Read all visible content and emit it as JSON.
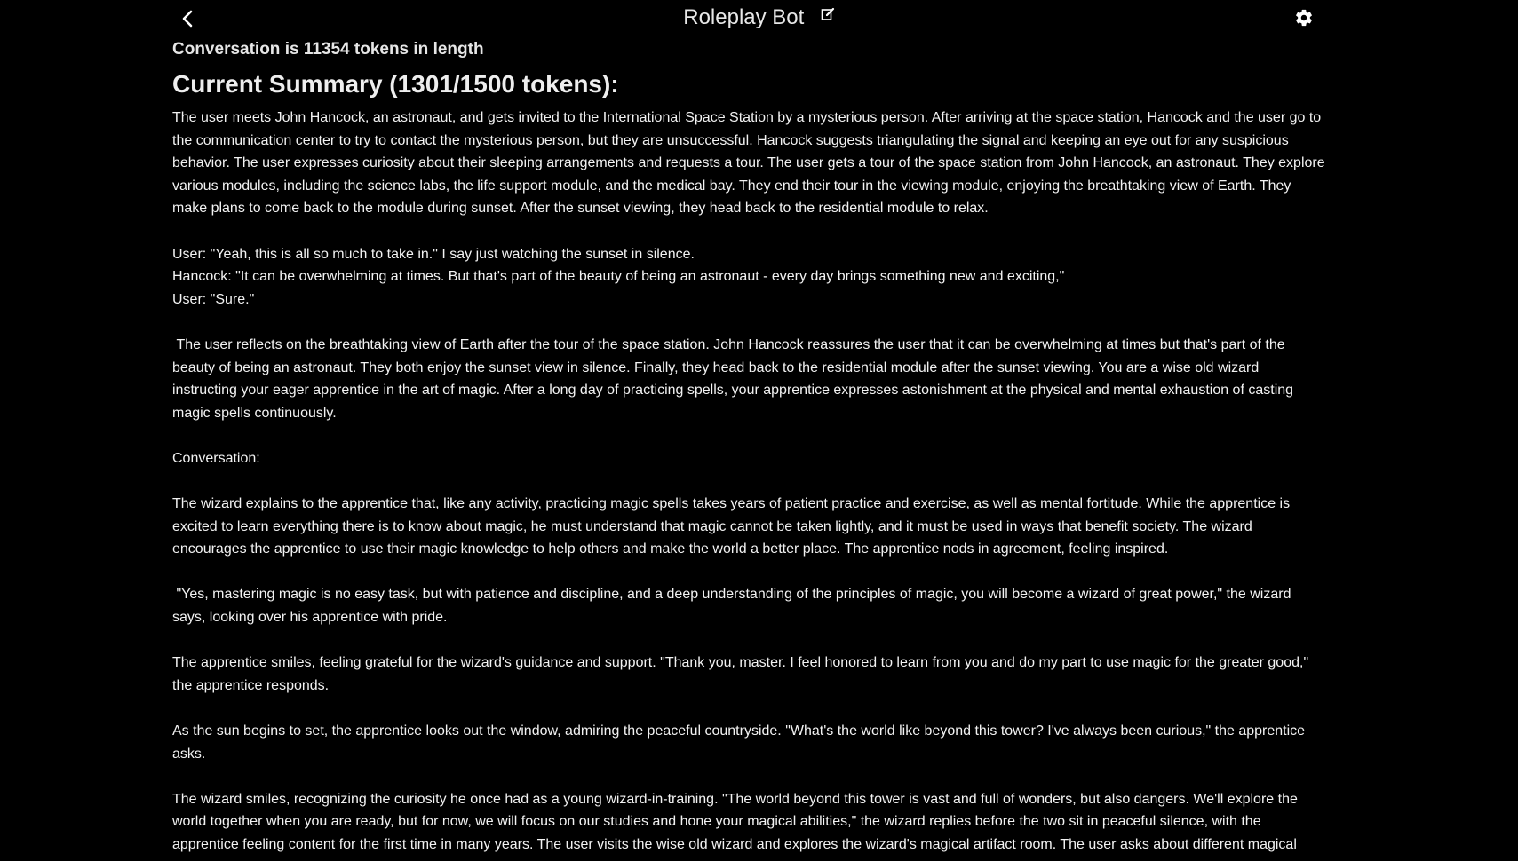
{
  "header": {
    "title": "Roleplay Bot",
    "back_icon": "chevron-left-icon",
    "edit_icon": "edit-icon",
    "settings_icon": "gear-icon"
  },
  "conversation": {
    "token_info": "Conversation is 11354 tokens in length"
  },
  "summary": {
    "heading": "Current Summary (1301/1500 tokens):",
    "body": "The user meets John Hancock, an astronaut, and gets invited to the International Space Station by a mysterious person. After arriving at the space station, Hancock and the user go to the communication center to try to contact the mysterious person, but they are unsuccessful. Hancock suggests triangulating the signal and keeping an eye out for any suspicious behavior. The user expresses curiosity about their sleeping arrangements and requests a tour. The user gets a tour of the space station from John Hancock, an astronaut. They explore various modules, including the science labs, the life support module, and the medical bay. They end their tour in the viewing module, enjoying the breathtaking view of Earth. They make plans to come back to the module during sunset. After the sunset viewing, they head back to the residential module to relax.\n\nUser: \"Yeah, this is all so much to take in.\" I say just watching the sunset in silence.\nHancock: \"It can be overwhelming at times. But that's part of the beauty of being an astronaut - every day brings something new and exciting,\"\nUser: \"Sure.\"\n\n The user reflects on the breathtaking view of Earth after the tour of the space station. John Hancock reassures the user that it can be overwhelming at times but that's part of the beauty of being an astronaut. They both enjoy the sunset view in silence. Finally, they head back to the residential module after the sunset viewing. You are a wise old wizard instructing your eager apprentice in the art of magic. After a long day of practicing spells, your apprentice expresses astonishment at the physical and mental exhaustion of casting magic spells continuously.\n\nConversation:\n\nThe wizard explains to the apprentice that, like any activity, practicing magic spells takes years of patient practice and exercise, as well as mental fortitude. While the apprentice is excited to learn everything there is to know about magic, he must understand that magic cannot be taken lightly, and it must be used in ways that benefit society. The wizard encourages the apprentice to use their magic knowledge to help others and make the world a better place. The apprentice nods in agreement, feeling inspired.\n\n \"Yes, mastering magic is no easy task, but with patience and discipline, and a deep understanding of the principles of magic, you will become a wizard of great power,\" the wizard says, looking over his apprentice with pride.\n\nThe apprentice smiles, feeling grateful for the wizard's guidance and support. \"Thank you, master. I feel honored to learn from you and do my part to use magic for the greater good,\" the apprentice responds.\n\nAs the sun begins to set, the apprentice looks out the window, admiring the peaceful countryside. \"What's the world like beyond this tower? I've always been curious,\" the apprentice asks.\n\nThe wizard smiles, recognizing the curiosity he once had as a young wizard-in-training. \"The world beyond this tower is vast and full of wonders, but also dangers. We'll explore the world together when you are ready, but for now, we will focus on our studies and hone your magical abilities,\" the wizard replies before the two sit in peaceful silence, with the apprentice feeling content for the first time in many years. The user visits the wise old wizard and explores the wizard's magical artifact room. The user asks about different magical"
  },
  "colors": {
    "background": "#000000",
    "text": "#ffffff"
  }
}
